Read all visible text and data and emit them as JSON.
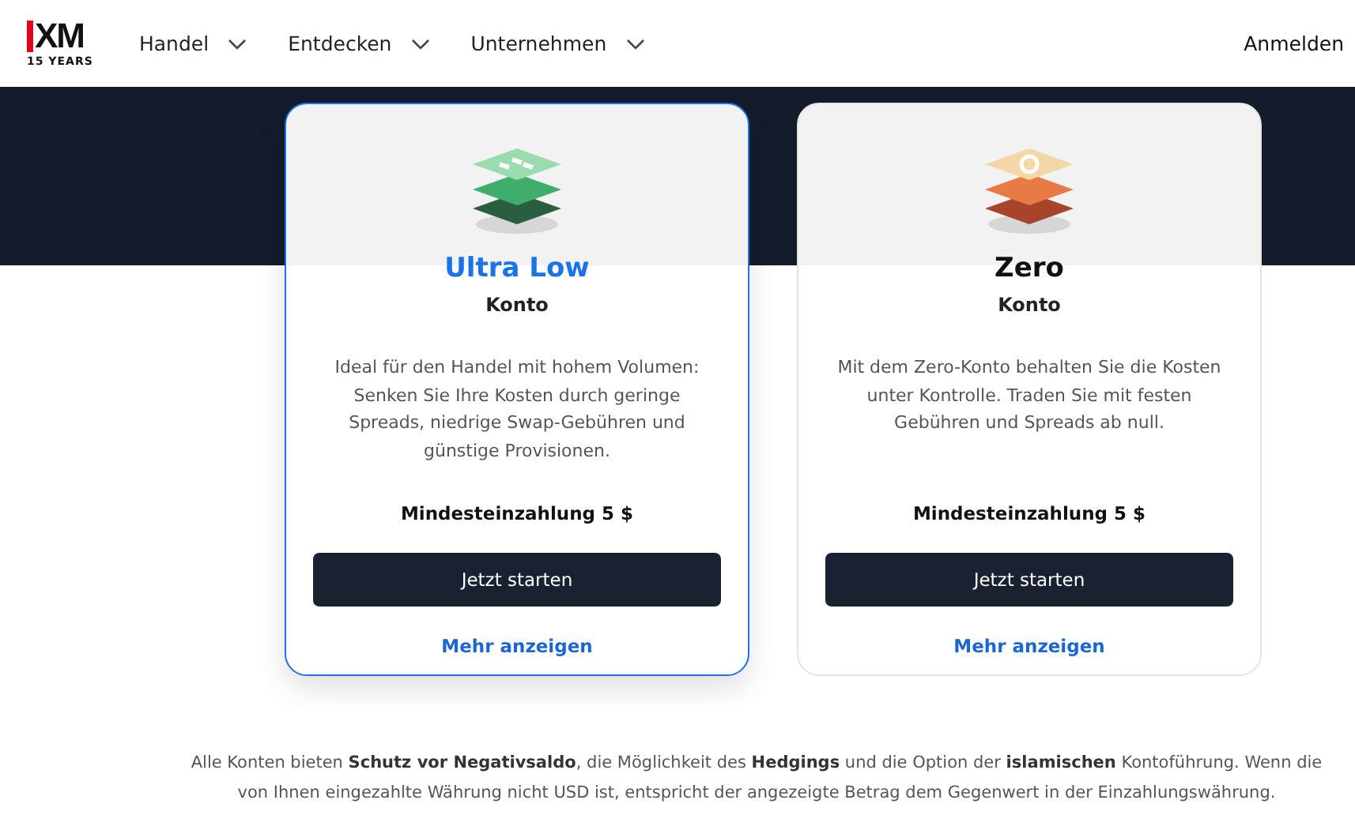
{
  "header": {
    "logo": {
      "mark": "XM",
      "tagline": "15 YEARS"
    },
    "nav": [
      {
        "label": "Handel"
      },
      {
        "label": "Entdecken"
      },
      {
        "label": "Unternehmen"
      }
    ],
    "login": "Anmelden"
  },
  "cards": [
    {
      "kind": "ultra-low",
      "selected": true,
      "title": "Ultra Low",
      "subtitle": "Konto",
      "description": "Ideal für den Handel mit hohem Volumen: Senken Sie Ihre Kosten durch geringe Spreads, niedrige Swap-Gebühren und günstige Provisionen.",
      "deposit": "Mindesteinzahlung 5 $",
      "button": "Jetzt starten",
      "link": "Mehr anzeigen"
    },
    {
      "kind": "zero",
      "selected": false,
      "title": "Zero",
      "subtitle": "Konto",
      "description": "Mit dem Zero-Konto behalten Sie die Kosten unter Kontrolle. Traden Sie mit festen Gebühren und Spreads ab null.",
      "deposit": "Mindesteinzahlung 5 $",
      "button": "Jetzt starten",
      "link": "Mehr anzeigen"
    }
  ],
  "footnote": "Alle Konten bieten **Schutz vor Negativsaldo**, die Möglichkeit des **Hedgings** und die Option der **islamischen** Kontoführung. Wenn die von Ihnen eingezahlte Währung nicht USD ist, entspricht der angezeigte Betrag dem Gegenwert in der Einzahlungswährung."
}
